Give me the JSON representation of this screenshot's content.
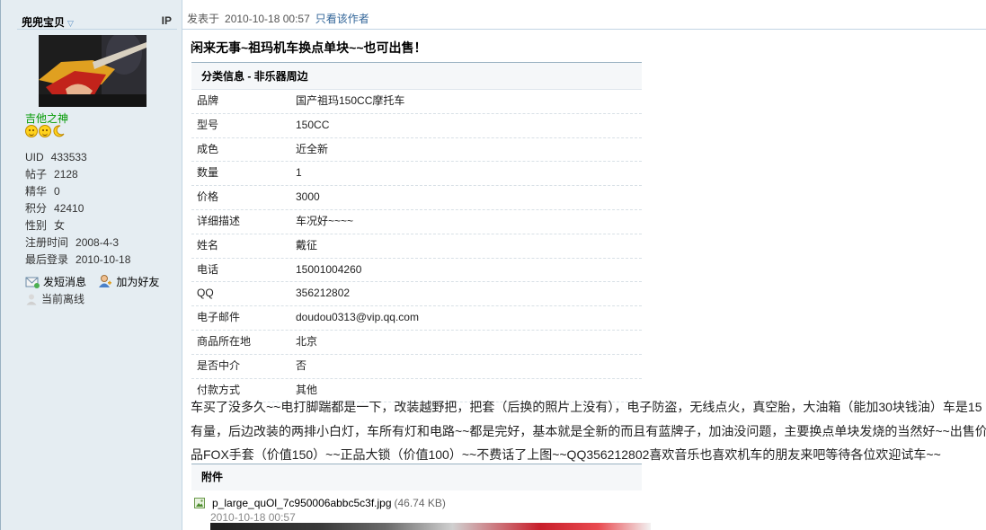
{
  "author": {
    "name": "兜兜宝贝",
    "ip_label": "IP",
    "group_title": "吉他之神",
    "stats": [
      {
        "key": "UID",
        "value": "433533"
      },
      {
        "key": "帖子",
        "value": "2128"
      },
      {
        "key": "精华",
        "value": "0"
      },
      {
        "key": "积分",
        "value": "42410"
      },
      {
        "key": "性别",
        "value": "女"
      },
      {
        "key": "注册时间",
        "value": "2008-4-3"
      },
      {
        "key": "最后登录",
        "value": "2010-10-18"
      }
    ],
    "actions": {
      "send_message": "发短消息",
      "add_friend": "加为好友"
    },
    "status": "当前离线",
    "rank_icons": [
      "smiley-icon",
      "smiley-icon",
      "moon-icon"
    ]
  },
  "post": {
    "posted_label": "发表于",
    "posted_at": "2010-10-18 00:57",
    "author_only_link": "只看该作者",
    "title": "闲来无事~祖玛机车换点单块~~也可出售！"
  },
  "classified": {
    "header": "分类信息  - 非乐器周边",
    "rows": [
      {
        "key": "品牌",
        "value": "国产祖玛150CC摩托车"
      },
      {
        "key": "型号",
        "value": "150CC"
      },
      {
        "key": "成色",
        "value": "近全新"
      },
      {
        "key": "数量",
        "value": "1"
      },
      {
        "key": "价格",
        "value": "3000"
      },
      {
        "key": "详细描述",
        "value": "车况好~~~~"
      },
      {
        "key": "姓名",
        "value": "戴征"
      },
      {
        "key": "电话",
        "value": "15001004260"
      },
      {
        "key": "QQ",
        "value": "356212802"
      },
      {
        "key": "电子邮件",
        "value": "doudou0313@vip.qq.com"
      },
      {
        "key": "商品所在地",
        "value": "北京"
      },
      {
        "key": "是否中介",
        "value": "否"
      },
      {
        "key": "付款方式",
        "value": "其他"
      }
    ]
  },
  "body": {
    "lines": [
      "车买了没多久~~电打脚踹都是一下，改装越野把，把套（后换的照片上没有），电子防盗，无线点火，真空胎，大油箱（能加30块钱油）车是15",
      "有量，后边改装的两排小白灯，车所有灯和电路~~都是完好，基本就是全新的而且有蓝牌子，加油没问题，主要换点单块发烧的当然好~~出售价",
      "品FOX手套（价值150）~~正品大锁（价值100）~~不费话了上图~~QQ356212802喜欢音乐也喜欢机车的朋友来吧等待各位欢迎试车~~"
    ]
  },
  "attachments": {
    "header": "附件",
    "file": {
      "name": "p_large_quOl_7c950006abbc5c3f.jpg",
      "size": "(46.74 KB)",
      "date": "2010-10-18 00:57"
    }
  },
  "colors": {
    "sidebar_bg": "#e5edf2",
    "link_blue": "#336699",
    "group_green": "#009900"
  }
}
